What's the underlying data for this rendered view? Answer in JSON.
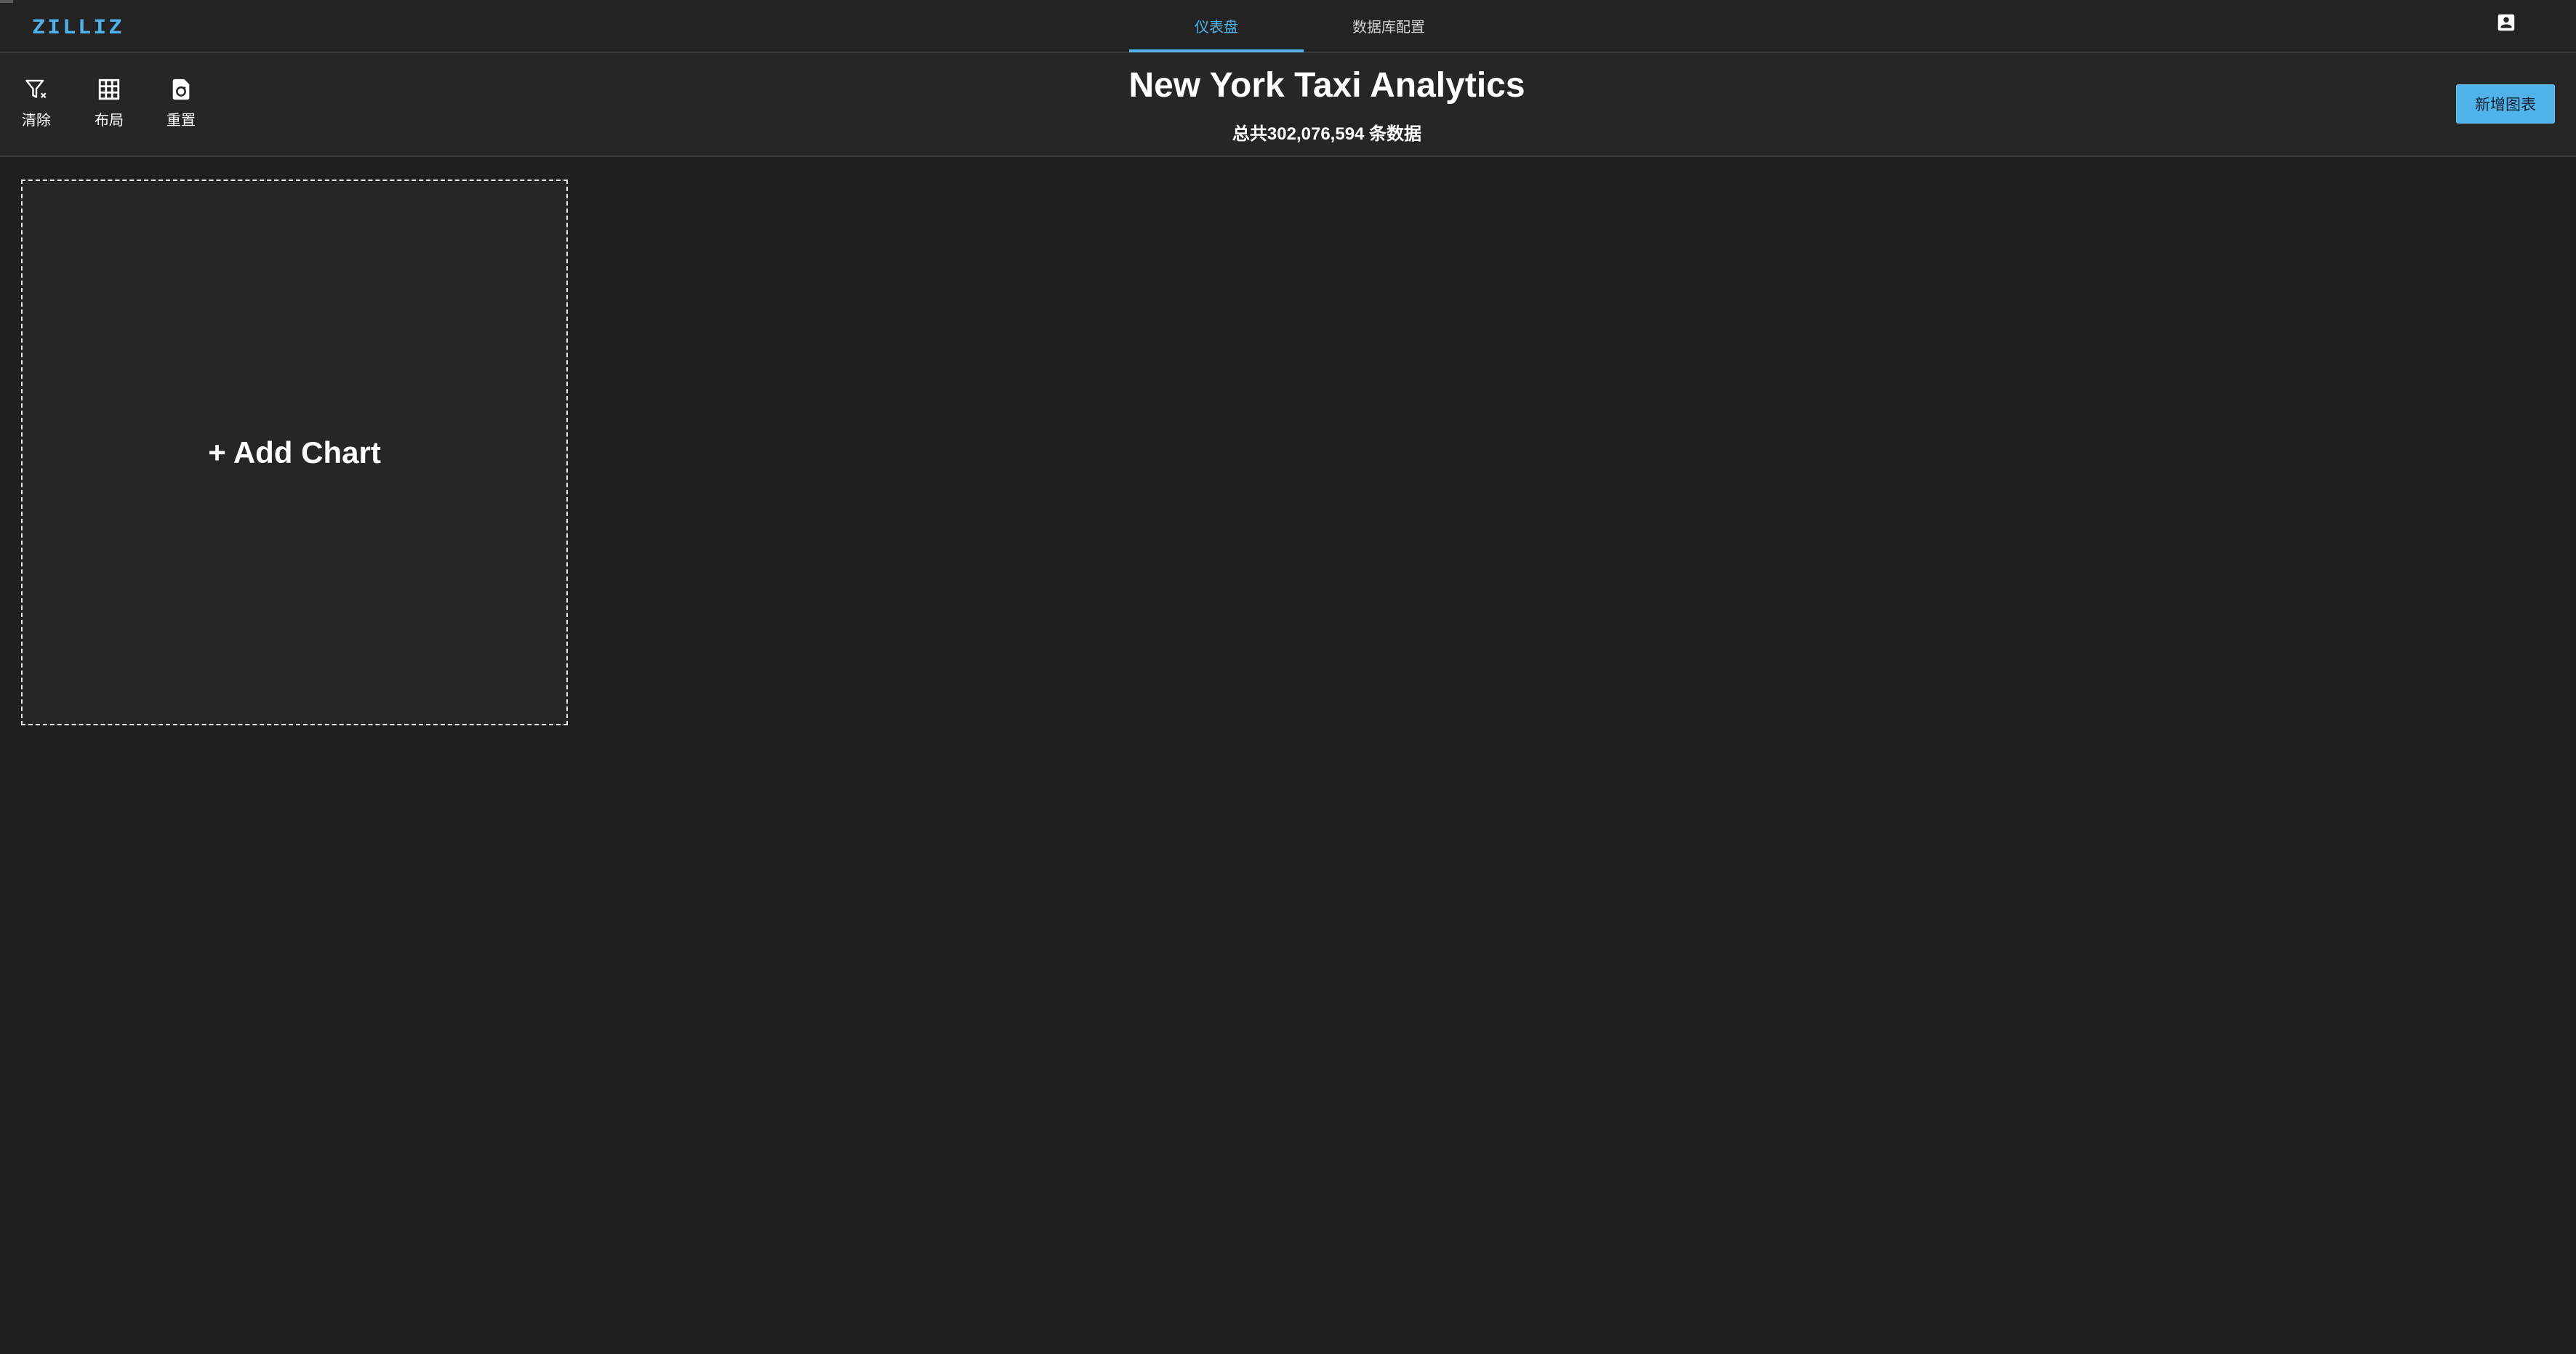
{
  "nav": {
    "logo": "ZILLIZ",
    "tabs": [
      {
        "label": "仪表盘",
        "active": true
      },
      {
        "label": "数据库配置",
        "active": false
      }
    ],
    "account_icon": "account-box-icon"
  },
  "toolbar": {
    "tools": [
      {
        "label": "清除",
        "icon": "filter-clear-icon"
      },
      {
        "label": "布局",
        "icon": "grid-icon"
      },
      {
        "label": "重置",
        "icon": "file-reset-icon"
      }
    ],
    "add_chart_button": "新增图表"
  },
  "header": {
    "title": "New York Taxi Analytics",
    "record_count": "总共302,076,594 条数据"
  },
  "main": {
    "add_chart_card_label": "+ Add Chart"
  },
  "colors": {
    "accent": "#4fb3ea",
    "background": "#1f1f1f",
    "panel": "#262626"
  }
}
